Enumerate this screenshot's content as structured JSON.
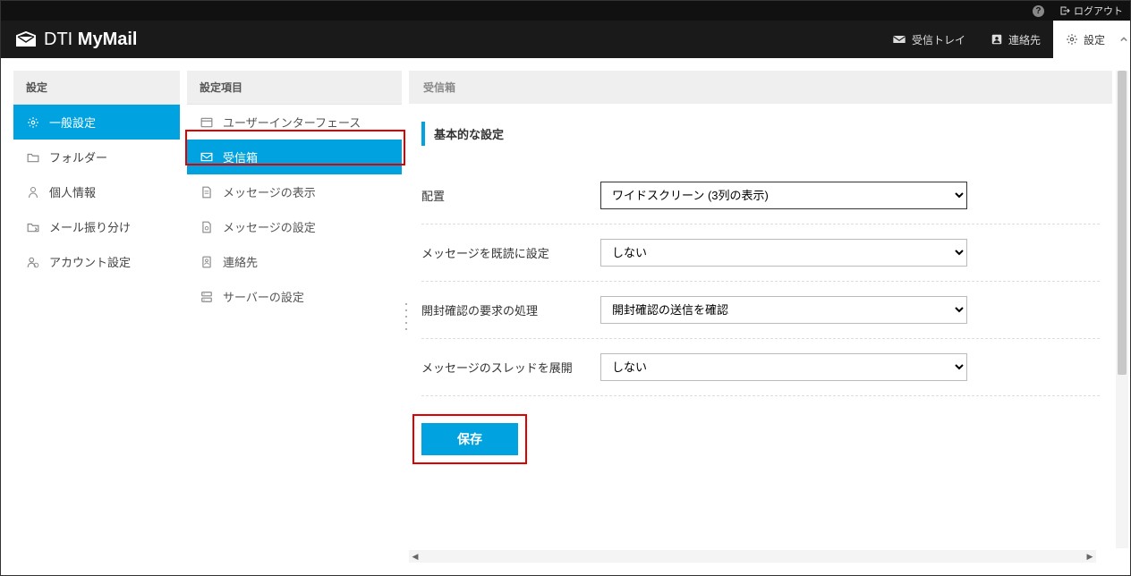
{
  "topbar": {
    "logout": "ログアウト"
  },
  "logo": {
    "brand1": "DTI",
    "brand2": "MyMail"
  },
  "nav": {
    "inbox": "受信トレイ",
    "contacts": "連絡先",
    "settings": "設定"
  },
  "settingsCol": {
    "header": "設定",
    "items": [
      {
        "label": "一般設定"
      },
      {
        "label": "フォルダー"
      },
      {
        "label": "個人情報"
      },
      {
        "label": "メール振り分け"
      },
      {
        "label": "アカウント設定"
      }
    ]
  },
  "itemsCol": {
    "header": "設定項目",
    "items": [
      {
        "label": "ユーザーインターフェース"
      },
      {
        "label": "受信箱"
      },
      {
        "label": "メッセージの表示"
      },
      {
        "label": "メッセージの設定"
      },
      {
        "label": "連絡先"
      },
      {
        "label": "サーバーの設定"
      }
    ]
  },
  "content": {
    "header": "受信箱",
    "section": "基本的な設定",
    "rows": {
      "layout": {
        "label": "配置",
        "value": "ワイドスクリーン (3列の表示)"
      },
      "markRead": {
        "label": "メッセージを既読に設定",
        "value": "しない"
      },
      "receipt": {
        "label": "開封確認の要求の処理",
        "value": "開封確認の送信を確認"
      },
      "thread": {
        "label": "メッセージのスレッドを展開",
        "value": "しない"
      }
    },
    "save": "保存"
  }
}
